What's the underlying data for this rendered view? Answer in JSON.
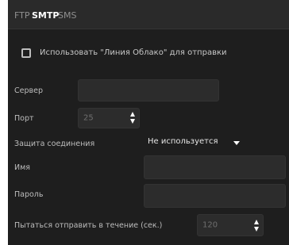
{
  "tabs": [
    {
      "label": "FTP",
      "active": false
    },
    {
      "label": "SMTP",
      "active": true
    },
    {
      "label": "SMS",
      "active": false
    }
  ],
  "use_cloud": {
    "label": "Использовать \"Линия Облако\" для отправки",
    "checked": false
  },
  "server": {
    "label": "Сервер",
    "value": ""
  },
  "port": {
    "label": "Порт",
    "value": "25"
  },
  "security": {
    "label": "Защита соединения",
    "selected": "Не используется"
  },
  "name": {
    "label": "Имя",
    "value": ""
  },
  "password": {
    "label": "Пароль",
    "value": ""
  },
  "retry": {
    "label": "Пытаться отправить в течение (сек.)",
    "value": "120"
  },
  "colors": {
    "background": "#1e1e1e",
    "tabbar": "#2a2a2a",
    "field": "#2c2c2c",
    "text": "#c9c9c9"
  }
}
